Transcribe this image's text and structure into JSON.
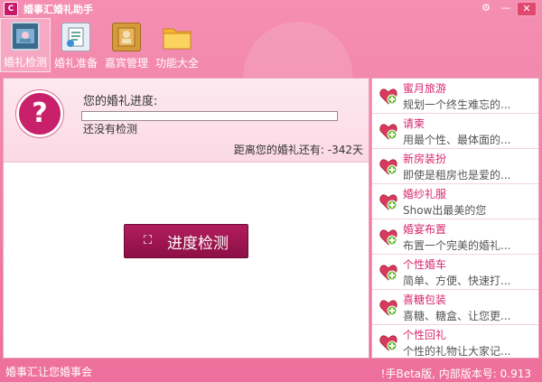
{
  "window": {
    "title": "婚事汇婚礼助手",
    "logo": "C"
  },
  "toolbar": {
    "items": [
      {
        "label": "婚礼检测",
        "icon": "monitor-icon",
        "active": true
      },
      {
        "label": "婚礼准备",
        "icon": "checklist-icon",
        "active": false
      },
      {
        "label": "嘉宾管理",
        "icon": "guestbook-icon",
        "active": false
      },
      {
        "label": "功能大全",
        "icon": "folder-icon",
        "active": false
      }
    ]
  },
  "progress": {
    "title": "您的婚礼进度:",
    "percent": 0,
    "status": "还没有检测",
    "countdown": "距离您的婚礼还有: -342天"
  },
  "check_button": {
    "label": "进度检测"
  },
  "services": [
    {
      "title": "蜜月旅游",
      "desc": "规划一个终生难忘的..."
    },
    {
      "title": "请柬",
      "desc": "用最个性、最体面的..."
    },
    {
      "title": "新房装扮",
      "desc": "即使是租房也是爱的..."
    },
    {
      "title": "婚纱礼服",
      "desc": "Show出最美的您"
    },
    {
      "title": "婚宴布置",
      "desc": "布置一个完美的婚礼..."
    },
    {
      "title": "个性婚车",
      "desc": "简单、方便、快速打..."
    },
    {
      "title": "喜糖包装",
      "desc": "喜糖、糖盒、让您更..."
    },
    {
      "title": "个性回礼",
      "desc": "个性的礼物让大家记..."
    }
  ],
  "statusbar": {
    "slogan": "婚事汇让您婚事会",
    "version": "!手Beta版, 内部版本号: 0.913"
  },
  "colors": {
    "accent": "#d6286d",
    "button": "#a0185a",
    "frame": "#f27ba3"
  }
}
